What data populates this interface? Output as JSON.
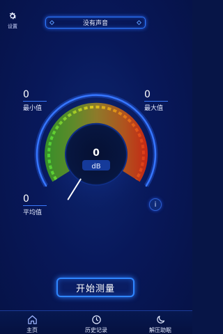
{
  "header": {
    "settings_label": "设置",
    "status_text": "没有声音"
  },
  "stats": {
    "min_value": "0",
    "min_label": "最小值",
    "max_value": "0",
    "max_label": "最大值",
    "avg_value": "0",
    "avg_label": "平均值"
  },
  "gauge": {
    "value": "0",
    "unit": "dB",
    "level_fraction": 0
  },
  "info_button": {
    "label": "i"
  },
  "start_button": {
    "label": "开始测量"
  },
  "nav": {
    "items": [
      {
        "label": "主页",
        "icon": "home-icon"
      },
      {
        "label": "历史记录",
        "icon": "clock-icon"
      },
      {
        "label": "解压助眠",
        "icon": "moon-icon"
      }
    ]
  },
  "colors": {
    "background": "#071547",
    "accent": "#2f86ff",
    "gauge_green": "#33c23a",
    "gauge_yellow": "#d8c21a",
    "gauge_red": "#d81c14"
  }
}
